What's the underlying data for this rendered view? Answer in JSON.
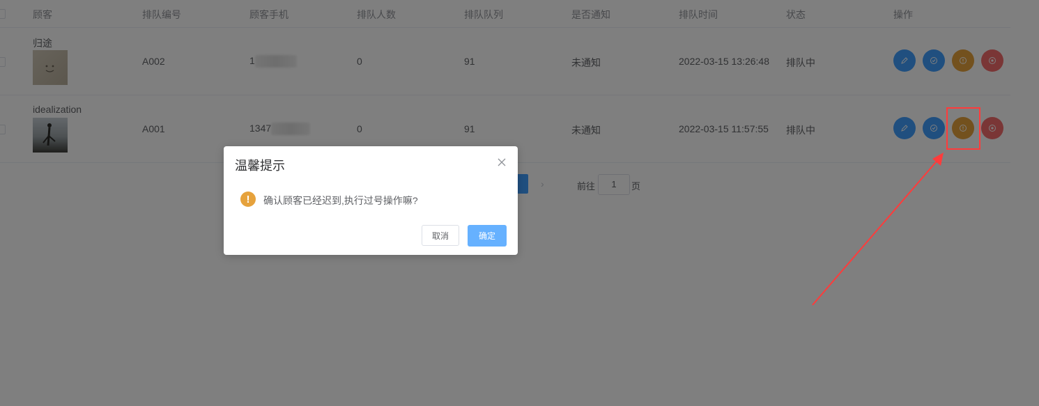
{
  "table": {
    "headers": [
      "顾客",
      "排队编号",
      "顾客手机",
      "排队人数",
      "排队队列",
      "是否通知",
      "排队时间",
      "状态",
      "操作"
    ],
    "rows": [
      {
        "customer": "归途",
        "number": "A002",
        "phone": "1",
        "people": "0",
        "queue": "91",
        "notified": "未通知",
        "time": "2022-03-15 13:26:48",
        "status": "排队中"
      },
      {
        "customer": "idealization",
        "number": "A001",
        "phone": "1347",
        "people": "0",
        "queue": "91",
        "notified": "未通知",
        "time": "2022-03-15 11:57:55",
        "status": "排队中"
      }
    ],
    "action_icons": [
      "edit-icon",
      "check-icon",
      "info-icon",
      "close-circle-icon"
    ]
  },
  "pagination": {
    "goto_label": "前往",
    "page_value": "1",
    "page_suffix": "页"
  },
  "dialog": {
    "title": "温馨提示",
    "message": "确认顾客已经迟到,执行过号操作嘛?",
    "cancel_label": "取消",
    "confirm_label": "确定",
    "warning_glyph": "!"
  },
  "colors": {
    "primary": "#409eff",
    "warning": "#e6a23c",
    "danger": "#f56c6c",
    "annotation": "#ff3b3b"
  }
}
